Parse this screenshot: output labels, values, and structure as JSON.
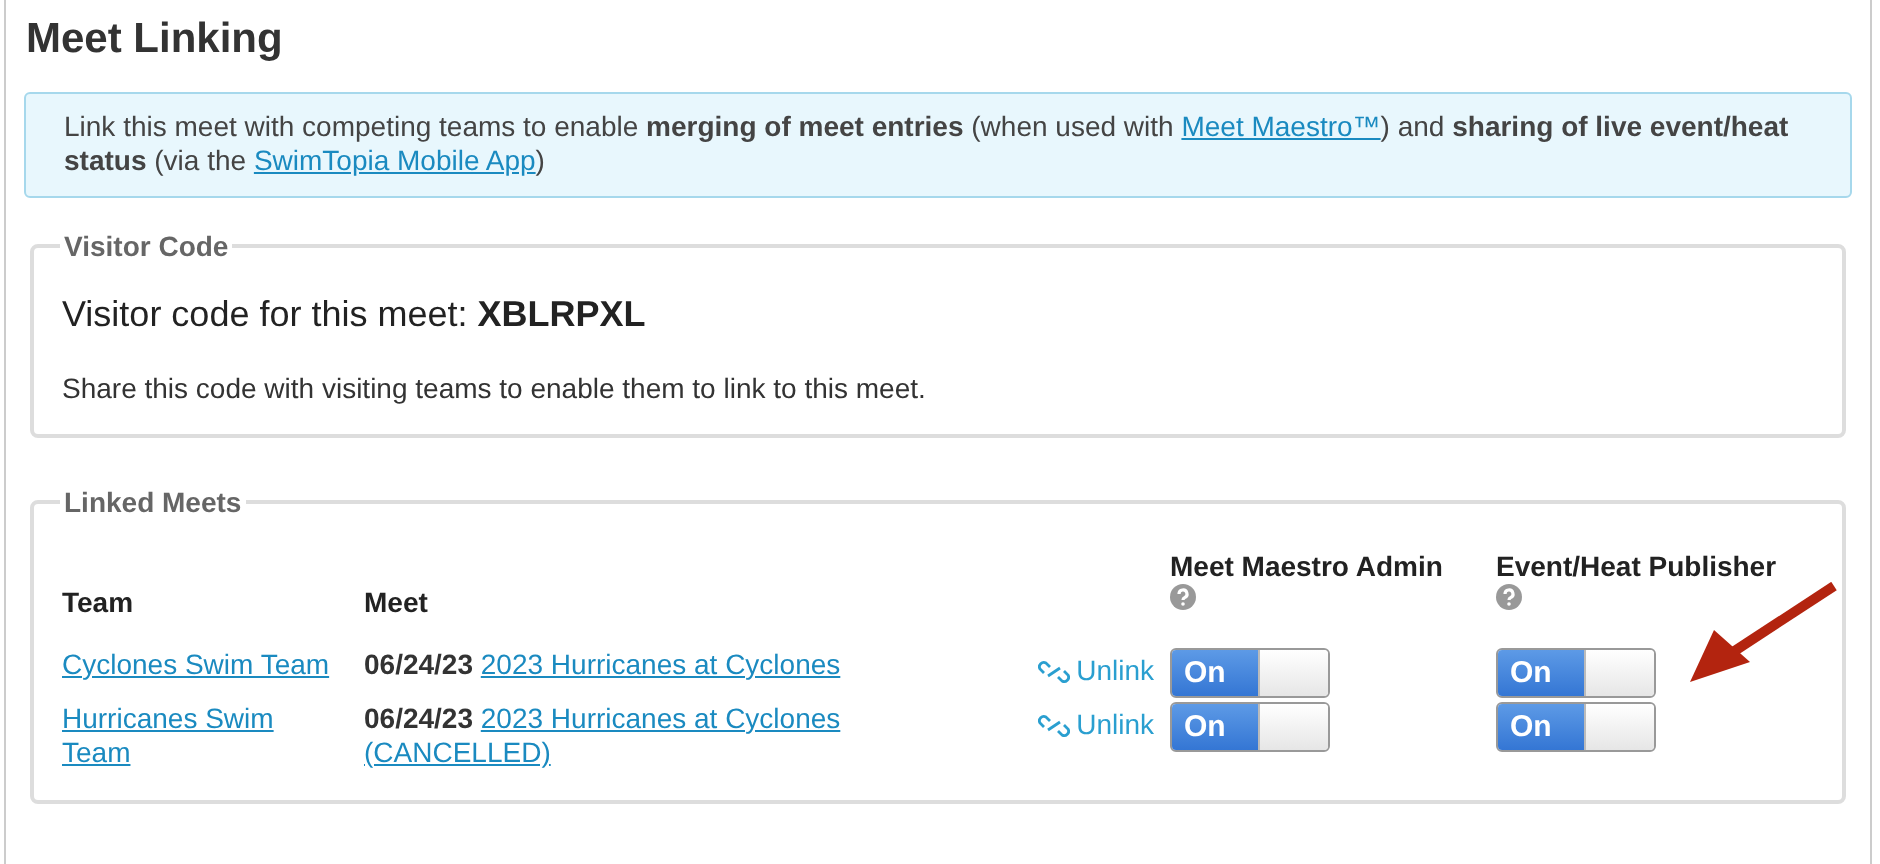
{
  "title": "Meet Linking",
  "info": {
    "text": "Link this meet with competing teams to enable **merging of meet entries** (when used with ",
    "link1": "Meet Maestro™",
    "middle": ") and **sharing of live event/heat status** (via the ",
    "link2": "SwimTopia Mobile App",
    "end": ")"
  },
  "visitor_code": {
    "legend": "Visitor Code",
    "label": "Visitor code for this meet:",
    "code": "XBLRPXL",
    "note": "Share this code with visiting teams to enable them to link to this meet."
  },
  "linked_meets": {
    "legend": "Linked Meets",
    "columns": [
      "Team",
      "Meet",
      "Meet Maestro Admin",
      "Event/Heat Publisher"
    ],
    "rows": [
      {
        "team": "Cyclones Swim Team",
        "date": "06/24/23",
        "meet": "2023 Hurricanes at Cyclones",
        "unlink": "Unlink",
        "admin": {
          "label": "On",
          "on": true
        },
        "publisher": {
          "label": "On",
          "on": true
        }
      },
      {
        "team": "Hurricanes Swim Team",
        "date": "06/24/23",
        "meet": "2023 Hurricanes at Cyclones (CANCELLED)",
        "unlink": "Unlink",
        "admin": {
          "label": "On",
          "on": true
        },
        "publisher": {
          "label": "On",
          "on": true
        }
      }
    ]
  }
}
